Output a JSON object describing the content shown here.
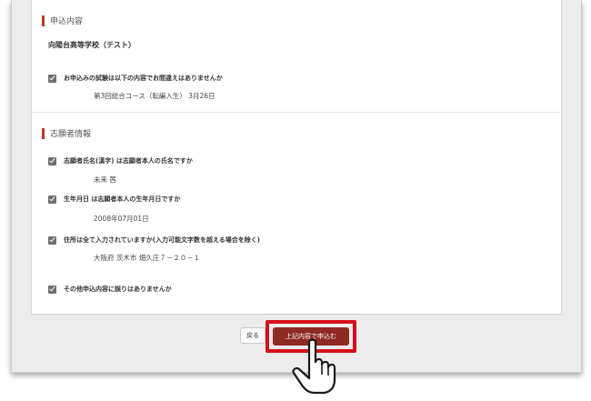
{
  "section_application": {
    "heading": "申込内容"
  },
  "school_name": "向陽台高等学校（テスト）",
  "application_check": {
    "question": "お申込みの試験は以下の内容でお間違えはありませんか",
    "answer": "第3回総合コース（転編入生） 3月26日"
  },
  "section_applicant": {
    "heading": "志願者情報"
  },
  "applicant_checks": [
    {
      "question": "志願者氏名(漢字) は志願者本人の氏名ですか",
      "answer": "未来 茜"
    },
    {
      "question": "生年月日 は志願者本人の生年月日ですか",
      "answer": "2008年07月01日"
    },
    {
      "question": "住所は全て入力されていますか(入力可能文字数を超える場合を除く)",
      "answer": "大阪府 茨木市 畑久庄７－２０－１"
    }
  ],
  "final_check": {
    "question": "その他申込内容に誤りはありませんか"
  },
  "buttons": {
    "back": "戻る",
    "submit": "上記内容で申込む"
  },
  "colors": {
    "accent_bar": "#c0392b",
    "submit_bg": "#8e2a22",
    "highlight_border": "#d8101b"
  }
}
